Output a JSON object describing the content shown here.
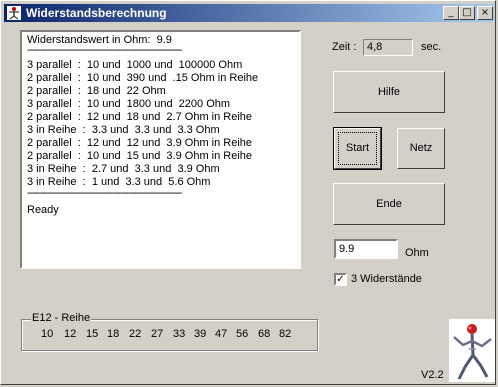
{
  "window": {
    "title": "Widerstandsberechnung",
    "caption_buttons": {
      "minimize": "_",
      "maximize": "□",
      "close": "×"
    }
  },
  "results": {
    "header": "Widerstandswert in Ohm:  9.9",
    "separator": "----------------------------------------------------------",
    "lines": [
      "3 parallel  :  10 und  1000 und  100000 Ohm",
      "2 parallel  :  10 und  390 und  .15 Ohm in Reihe",
      "2 parallel  :  18 und  22 Ohm",
      "3 parallel  :  10 und  1800 und  2200 Ohm",
      "2 parallel  :  12 und  18 und  2.7 Ohm in Reihe",
      "3 in Reihe  :  3.3 und  3.3 und  3.3 Ohm",
      "2 parallel  :  12 und  12 und  3.9 Ohm in Reihe",
      "2 parallel  :  10 und  15 und  3.9 Ohm in Reihe",
      "3 in Reihe  :  2.7 und  3.3 und  3.9 Ohm",
      "3 in Reihe  :  1 und  3.3 und  5.6 Ohm"
    ],
    "separator2": "----------------------------------------------------------",
    "status": "Ready"
  },
  "timer": {
    "label": "Zeit :",
    "value": "4,8",
    "unit": "sec."
  },
  "buttons": {
    "help": "Hilfe",
    "start": "Start",
    "net": "Netz",
    "end": "Ende"
  },
  "resistance_input": {
    "value": "9.9",
    "unit": "Ohm"
  },
  "three_resistors": {
    "label": "3 Widerstände",
    "checked": true,
    "mark": "✓"
  },
  "e12": {
    "title": "E12 - Reihe",
    "values": [
      "10",
      "12",
      "15",
      "18",
      "22",
      "27",
      "33",
      "39",
      "47",
      "56",
      "68",
      "82"
    ]
  },
  "version": "V2.2"
}
